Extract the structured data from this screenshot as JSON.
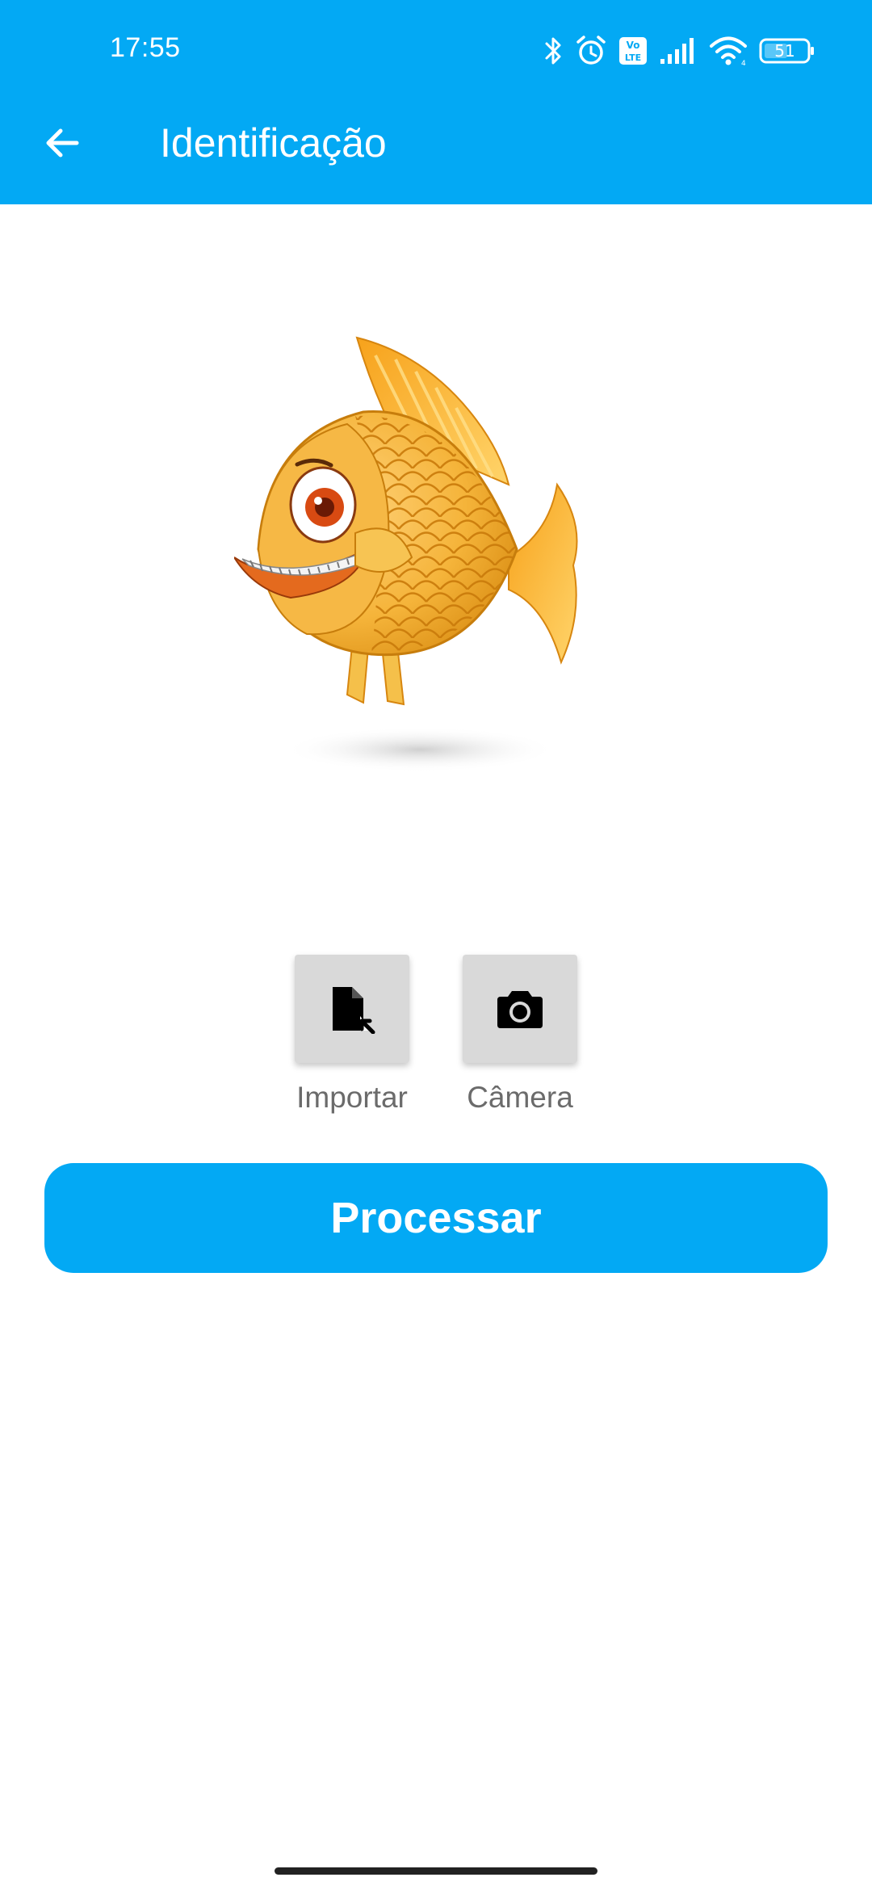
{
  "status_bar": {
    "time": "17:55",
    "battery": "51",
    "icons": [
      "bluetooth-icon",
      "alarm-icon",
      "volte-icon",
      "signal-icon",
      "wifi-icon",
      "battery-icon"
    ]
  },
  "app_bar": {
    "title": "Identificação",
    "back_icon": "arrow-left-icon"
  },
  "main": {
    "image": "fish-illustration",
    "actions": [
      {
        "label": "Importar",
        "icon": "file-import-icon"
      },
      {
        "label": "Câmera",
        "icon": "camera-icon"
      }
    ],
    "process_label": "Processar"
  },
  "colors": {
    "primary": "#03A9F4",
    "tile": "#D9D9D9",
    "label": "#6B6B6B"
  }
}
